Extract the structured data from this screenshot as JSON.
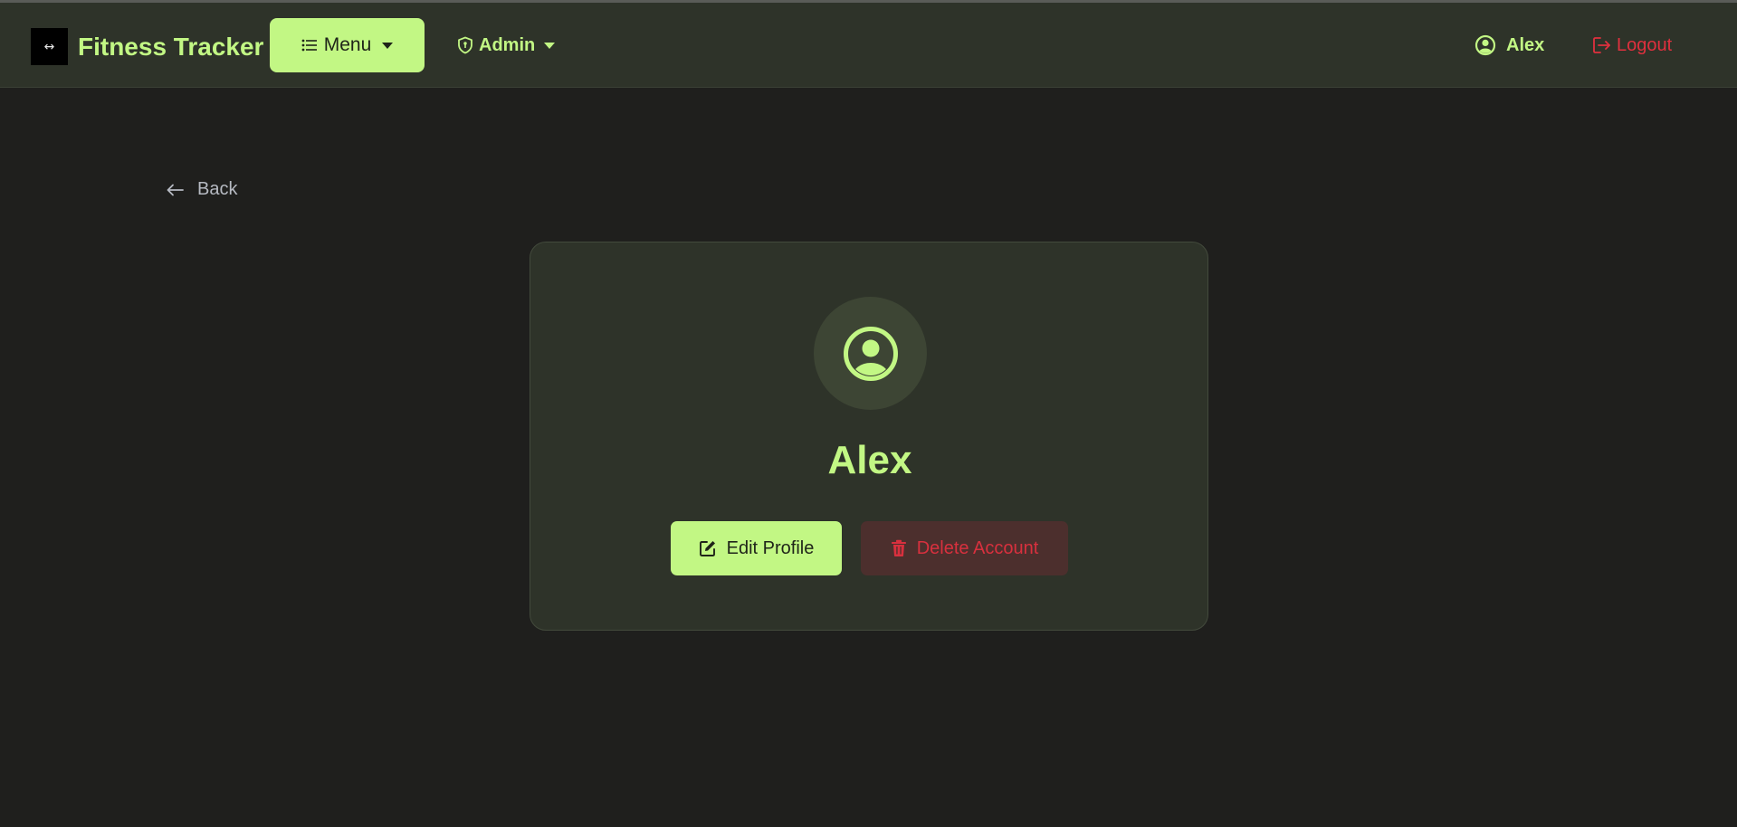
{
  "navbar": {
    "brand_logo_glyph": "↔",
    "brand_title": "Fitness Tracker",
    "menu_label": "Menu",
    "admin_label": "Admin",
    "user_label": "Alex",
    "logout_label": "Logout"
  },
  "back_label": "Back",
  "profile": {
    "name": "Alex",
    "edit_label": "Edit Profile",
    "delete_label": "Delete Account"
  },
  "icons": {
    "menu": "list-icon",
    "admin": "shield-icon",
    "user": "user-circle-icon",
    "logout": "logout-icon",
    "back": "arrow-left-icon",
    "avatar": "user-circle-icon",
    "edit": "edit-icon",
    "delete": "trash-icon"
  },
  "colors": {
    "accent": "#c2f784",
    "danger": "#e0303e",
    "background": "#1f1f1d",
    "surface": "#2e3329"
  }
}
